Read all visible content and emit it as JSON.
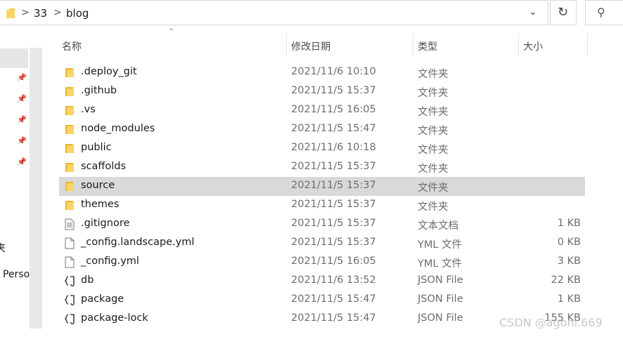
{
  "address": {
    "crumbs": [
      "33",
      "blog"
    ],
    "separator": ">",
    "dropdown_glyph": "⌄",
    "refresh_glyph": "↻",
    "search_glyph": "⚲"
  },
  "nav": {
    "fragments": [
      "夹",
      "Perso"
    ]
  },
  "columns": {
    "name": "名称",
    "date": "修改日期",
    "type": "类型",
    "size": "大小",
    "sort_glyph": "^"
  },
  "files": [
    {
      "name": ".deploy_git",
      "date": "2021/11/6 10:10",
      "type": "文件夹",
      "size": "",
      "icon": "folder-icon"
    },
    {
      "name": ".github",
      "date": "2021/11/5 15:37",
      "type": "文件夹",
      "size": "",
      "icon": "folder-icon"
    },
    {
      "name": ".vs",
      "date": "2021/11/5 16:05",
      "type": "文件夹",
      "size": "",
      "icon": "folder-icon"
    },
    {
      "name": "node_modules",
      "date": "2021/11/5 15:47",
      "type": "文件夹",
      "size": "",
      "icon": "folder-icon"
    },
    {
      "name": "public",
      "date": "2021/11/6 10:18",
      "type": "文件夹",
      "size": "",
      "icon": "folder-icon"
    },
    {
      "name": "scaffolds",
      "date": "2021/11/5 15:37",
      "type": "文件夹",
      "size": "",
      "icon": "folder-icon"
    },
    {
      "name": "source",
      "date": "2021/11/5 15:37",
      "type": "文件夹",
      "size": "",
      "icon": "folder-icon",
      "selected": true
    },
    {
      "name": "themes",
      "date": "2021/11/5 15:37",
      "type": "文件夹",
      "size": "",
      "icon": "folder-icon"
    },
    {
      "name": ".gitignore",
      "date": "2021/11/5 15:37",
      "type": "文本文档",
      "size": "1 KB",
      "icon": "text-file-icon"
    },
    {
      "name": "_config.landscape.yml",
      "date": "2021/11/5 15:37",
      "type": "YML 文件",
      "size": "0 KB",
      "icon": "blank-file-icon"
    },
    {
      "name": "_config.yml",
      "date": "2021/11/5 16:05",
      "type": "YML 文件",
      "size": "3 KB",
      "icon": "blank-file-icon"
    },
    {
      "name": "db",
      "date": "2021/11/6 13:52",
      "type": "JSON File",
      "size": "22 KB",
      "icon": "json-file-icon"
    },
    {
      "name": "package",
      "date": "2021/11/5 15:47",
      "type": "JSON File",
      "size": "1 KB",
      "icon": "json-file-icon"
    },
    {
      "name": "package-lock",
      "date": "2021/11/5 15:47",
      "type": "JSON File",
      "size": "155 KB",
      "icon": "json-file-icon"
    }
  ],
  "watermark": "CSDN @agoni.669",
  "colors": {
    "folder": "#f6c94a",
    "selected_row": "#d9d9d9",
    "secondary_text": "#6d6d6d"
  }
}
